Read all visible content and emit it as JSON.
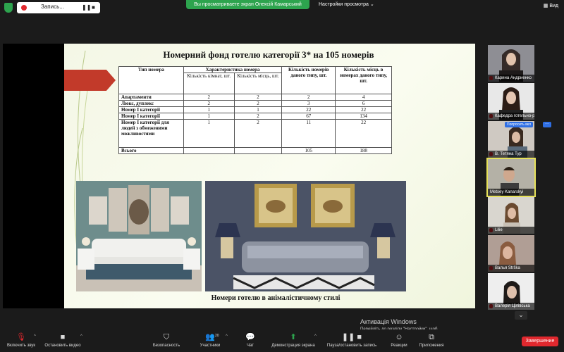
{
  "top": {
    "recording_label": "Запись...",
    "pause_glyph": "❚❚",
    "stop_glyph": "■",
    "share_banner": "Вы просматриваете экран Олексій Камарський",
    "view_options": "Настройки просмотра",
    "view_button": "Вид"
  },
  "slide": {
    "title": "Номерний фонд готелю категорії 3* на 105 номерів",
    "caption": "Номери готелю в анімалістичному стилі",
    "table": {
      "h_type": "Тип номера",
      "h_char": "Характеристика номера",
      "h_rooms": "Кількість кімнат, шт.",
      "h_places": "Кількість місць, шт.",
      "h_count": "Кількість номерів даного типу, шт.",
      "h_total": "Кількість місць в номерах даного типу, шт.",
      "rows": [
        {
          "type": "Апартаменти",
          "rooms": "2",
          "places": "2",
          "count": "2",
          "total": "4"
        },
        {
          "type": "Люкс, дуплекс",
          "rooms": "2",
          "places": "2",
          "count": "3",
          "total": "6"
        },
        {
          "type": "Номер І категорії",
          "rooms": "1",
          "places": "1",
          "count": "22",
          "total": "22"
        },
        {
          "type": "Номер І категорії",
          "rooms": "1",
          "places": "2",
          "count": "67",
          "total": "134"
        },
        {
          "type": "Номер І категорії для людей з обмеженими можливостями",
          "rooms": "1",
          "places": "2",
          "count": "11",
          "total": "22"
        }
      ],
      "total_label": "Всього",
      "total_count": "105",
      "total_places": "188"
    }
  },
  "activation": {
    "line1": "Активація Windows",
    "line2": "Перейдіть до розділу \"Настройки\", щоб"
  },
  "participants": [
    {
      "name": "Карина Андриенко"
    },
    {
      "name": "Кафедра готельно-р..."
    },
    {
      "name": "В. Тетяна Тур"
    },
    {
      "name": "Metsey Kanarskyi"
    },
    {
      "name": "Lilie"
    },
    {
      "name": "Валья Strška"
    },
    {
      "name": "Валерія Цілівська"
    }
  ],
  "ask_label": "Попросить вкл",
  "chevron": "⌄",
  "toolbar": {
    "audio": "Включить звук",
    "video": "Остановить видео",
    "security": "Безопасность",
    "participants": "Участники",
    "participants_count": "20",
    "chat": "Чат",
    "share": "Демонстрация экрана",
    "pause_share": "Пауза/остановить запись",
    "reactions": "Реакции",
    "apps": "Приложения",
    "end": "Завершение"
  }
}
